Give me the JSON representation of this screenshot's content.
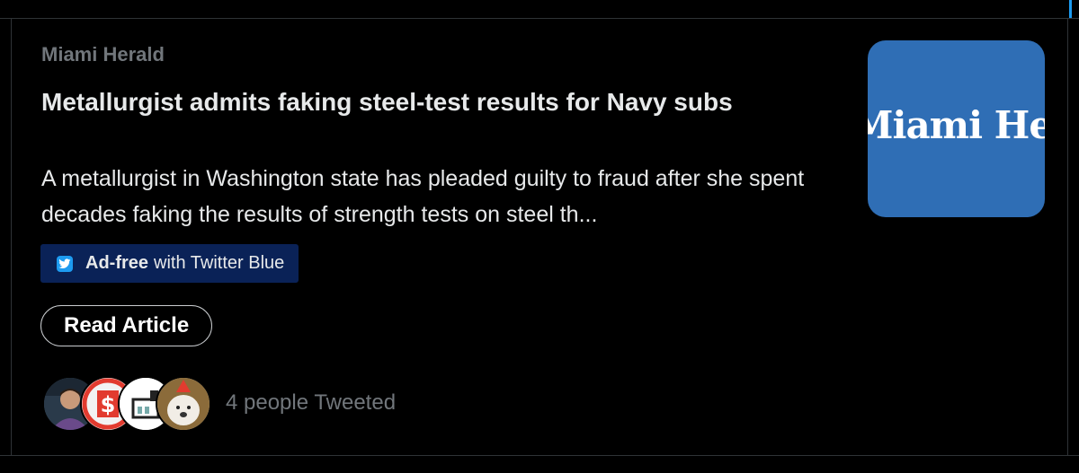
{
  "card": {
    "source": "Miami Herald",
    "headline": "Metallurgist admits faking steel-test results for Navy subs",
    "summary": "A metallurgist in Washington state has pleaded guilty to fraud after she spent decades faking the results of strength tests on steel th...",
    "thumbnail_text": "Miami Herald",
    "thumbnail_color": "#2f6eb5"
  },
  "ad": {
    "icon": "twitter-bird-icon",
    "bold_label": "Ad-free",
    "label": "with Twitter Blue",
    "background": "#0a2257"
  },
  "actions": {
    "read_label": "Read Article"
  },
  "social": {
    "avatars": [
      "avatar-person",
      "avatar-dollar-sign",
      "avatar-building",
      "avatar-dog"
    ],
    "tweet_count_label": "4 people Tweeted"
  },
  "colors": {
    "background": "#000000",
    "text_primary": "#e7e9ea",
    "text_secondary": "#71767b",
    "accent": "#1d9bf0"
  }
}
